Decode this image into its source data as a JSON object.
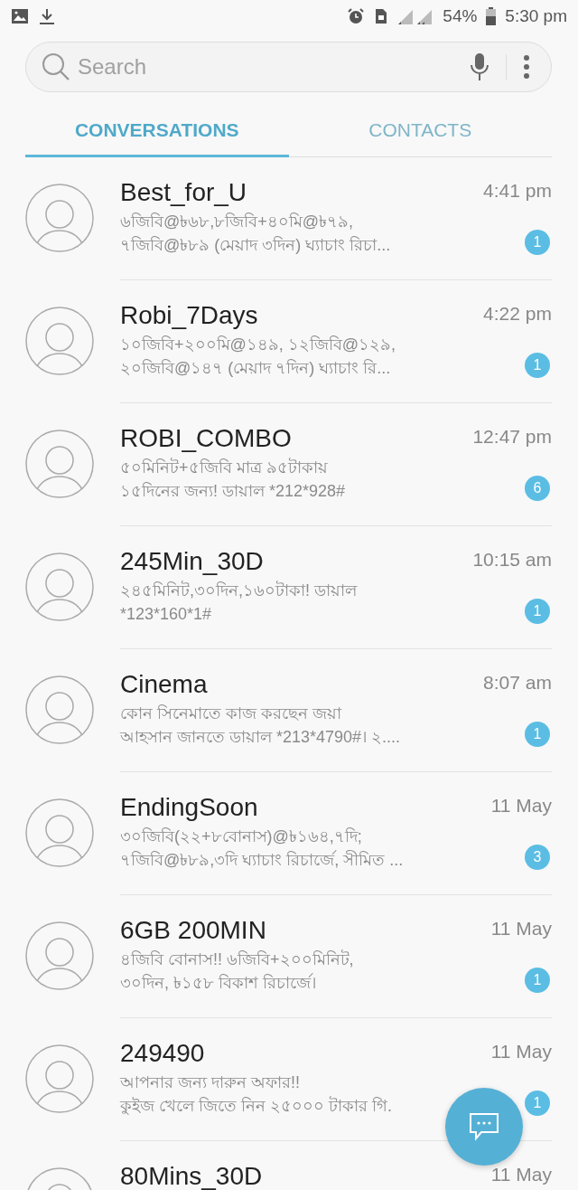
{
  "status_bar": {
    "battery": "54%",
    "time": "5:30 pm"
  },
  "search": {
    "placeholder": "Search"
  },
  "tabs": [
    {
      "label": "CONVERSATIONS",
      "selected": true
    },
    {
      "label": "CONTACTS",
      "selected": false
    }
  ],
  "conversations": [
    {
      "name": "Best_for_U",
      "time": "4:41 pm",
      "preview": [
        "৬জিবি@৳৬৮,৮জিবি+৪০মি@৳৭৯,",
        "৭জিবি@৳৮৯ (মেয়াদ ৩দিন) ঘ্যাচাং রিচা..."
      ],
      "unread": "1"
    },
    {
      "name": "Robi_7Days",
      "time": "4:22 pm",
      "preview": [
        "১০জিবি+২০০মি@১৪৯, ১২জিবি@১২৯,",
        "২০জিবি@১৪৭ (মেয়াদ ৭দিন) ঘ্যাচাং রি..."
      ],
      "unread": "1"
    },
    {
      "name": "ROBI_COMBO",
      "time": "12:47 pm",
      "preview": [
        "৫০মিনিট+৫জিবি মাত্র ৯৫টাকায়",
        "১৫দিনের জন্য! ডায়াল *212*928#"
      ],
      "unread": "6"
    },
    {
      "name": "245Min_30D",
      "time": "10:15 am",
      "preview": [
        "২৪৫মিনিট,৩০দিন,১৬০টাকা! ডায়াল",
        "*123*160*1#"
      ],
      "unread": "1"
    },
    {
      "name": "Cinema",
      "time": "8:07 am",
      "preview": [
        "কোন সিনেমাতে কাজ করছেন জয়া",
        "আহসান জানতে ডায়াল *213*4790#। ২...."
      ],
      "unread": "1"
    },
    {
      "name": "EndingSoon",
      "time": "11 May",
      "preview": [
        "৩০জিবি(২২+৮বোনাস)@৳১৬৪,৭দি;",
        "৭জিবি@৳৮৯,৩দি ঘ্যাচাং রিচার্জে, সীমিত ..."
      ],
      "unread": "3"
    },
    {
      "name": "6GB 200MIN",
      "time": "11 May",
      "preview": [
        "৪জিবি বোনাস!! ৬জিবি+২০০মিনিট,",
        "৩০দিন, ৳১৫৮ বিকাশ রিচার্জে।"
      ],
      "unread": "1"
    },
    {
      "name": "249490",
      "time": "11 May",
      "preview": [
        "আপনার জন্য দারুন অফার!!",
        "কুইজ খেলে জিতে নিন ২৫০০০ টাকার গি."
      ],
      "unread": "1"
    },
    {
      "name": "80Mins_30D",
      "time": "11 May"
    }
  ]
}
